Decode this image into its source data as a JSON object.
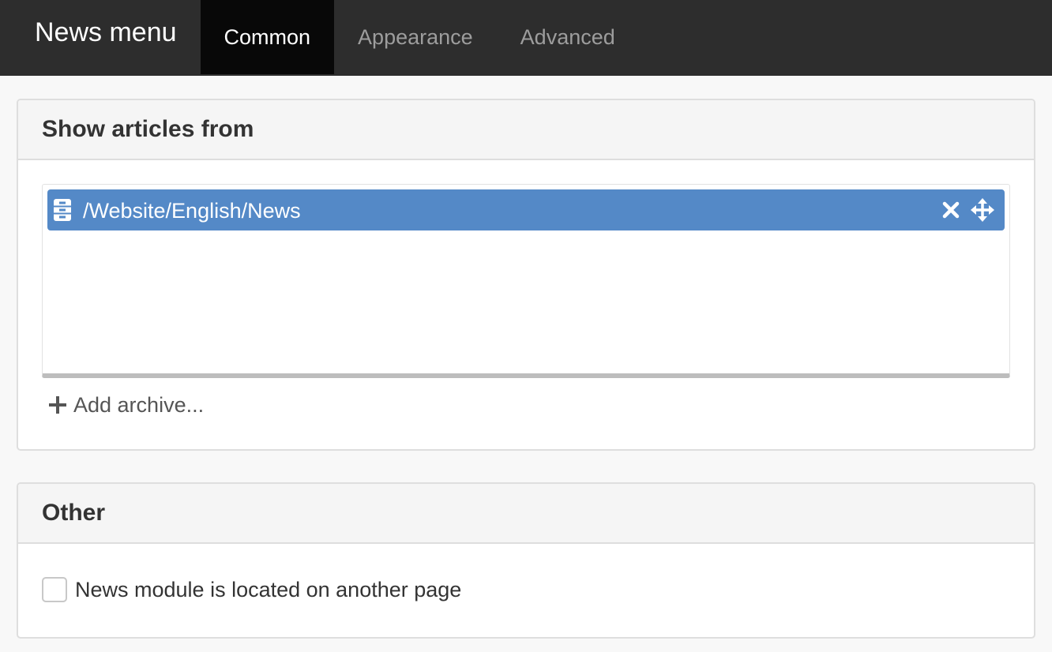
{
  "header": {
    "title": "News menu",
    "tabs": [
      {
        "label": "Common",
        "active": true
      },
      {
        "label": "Appearance",
        "active": false
      },
      {
        "label": "Advanced",
        "active": false
      }
    ]
  },
  "sections": {
    "show_articles": {
      "heading": "Show articles from",
      "archives": [
        {
          "path": "/Website/English/News",
          "icon": "archive-cabinet-icon"
        }
      ],
      "add_label": "Add archive..."
    },
    "other": {
      "heading": "Other",
      "checkbox_label": "News module is located on another page",
      "checked": false
    }
  },
  "colors": {
    "topbar": "#2d2d2d",
    "active_tab": "#080808",
    "selected_item": "#5489c7"
  }
}
